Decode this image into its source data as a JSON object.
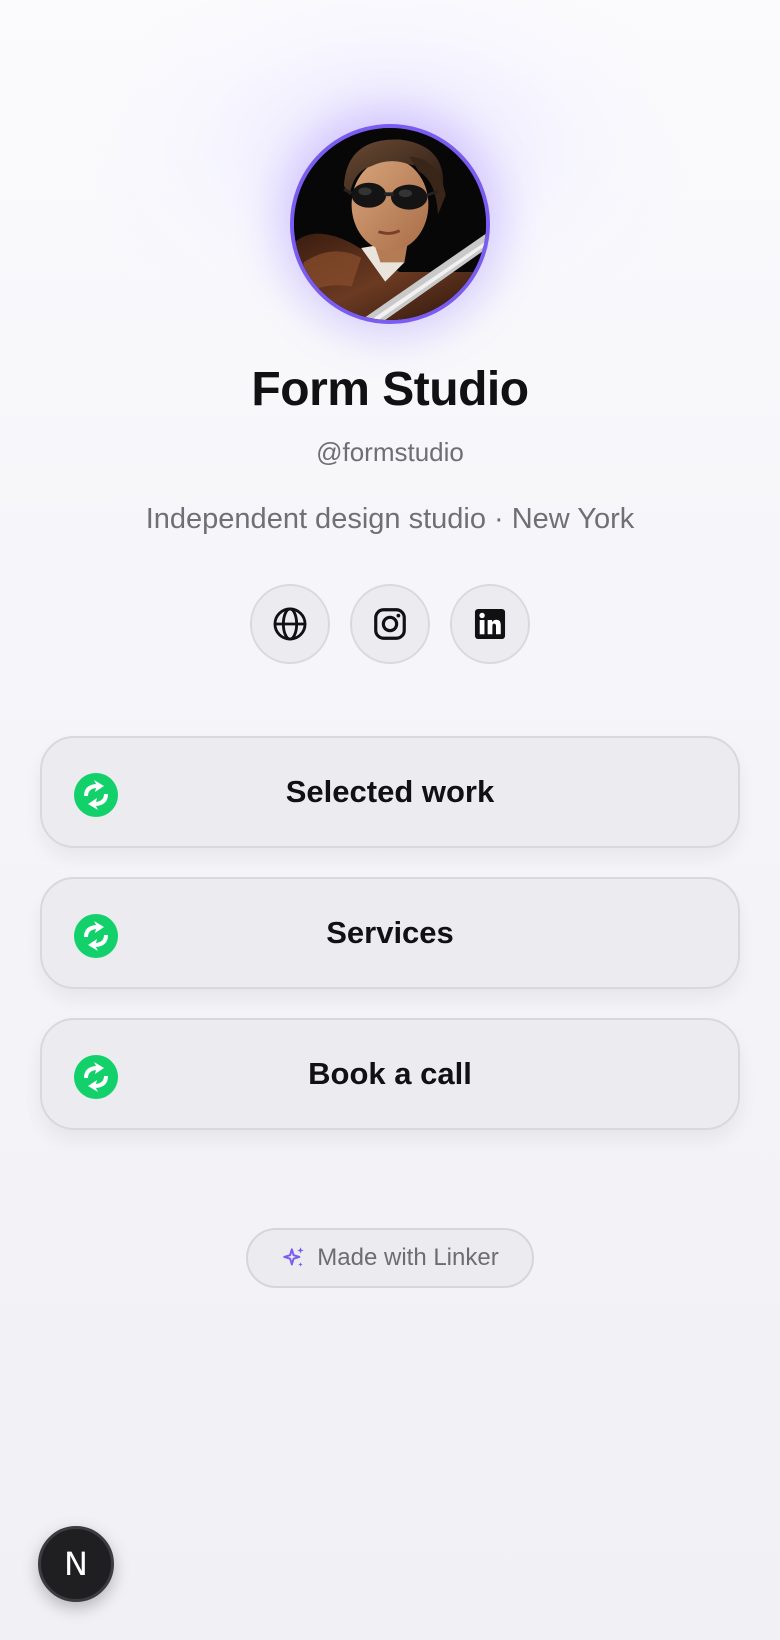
{
  "profile": {
    "name": "Form Studio",
    "handle": "@formstudio",
    "bio": "Independent design studio · New York",
    "avatar_icon": "profile-photo",
    "accent_color": "#7b5cf0"
  },
  "socials": [
    {
      "icon": "globe-icon",
      "label": "Website"
    },
    {
      "icon": "instagram-icon",
      "label": "Instagram"
    },
    {
      "icon": "linkedin-icon",
      "label": "LinkedIn"
    }
  ],
  "links": [
    {
      "label": "Selected work",
      "icon": "refresh-icon",
      "icon_color": "#12d16b"
    },
    {
      "label": "Services",
      "icon": "refresh-icon",
      "icon_color": "#12d16b"
    },
    {
      "label": "Book a call",
      "icon": "refresh-icon",
      "icon_color": "#12d16b"
    }
  ],
  "footer": {
    "badge_label": "Made with Linker",
    "badge_icon": "sparkle-icon",
    "badge_icon_color": "#7b5cf0"
  },
  "dev_indicator": {
    "label": "N",
    "icon": "nextjs-icon"
  }
}
